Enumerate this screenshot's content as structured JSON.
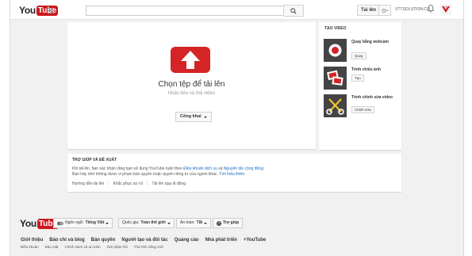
{
  "header": {
    "logo_you": "You",
    "logo_tube": "Tube",
    "search_placeholder": "",
    "upload_label": "Tải lên",
    "account_name": "VTTSOLUTION.CO"
  },
  "upload": {
    "title": "Chọn tệp để tải lên",
    "subtitle": "Hoặc kéo và thả video",
    "privacy_label": "Công khai"
  },
  "create_video": {
    "title": "TẠO VIDEO",
    "tools": [
      {
        "name": "Quay bằng webcam",
        "button": "Quay"
      },
      {
        "name": "Trình chiếu ảnh",
        "button": "Tạo"
      },
      {
        "name": "Trình chỉnh sửa video",
        "button": "Chỉnh sửa"
      }
    ]
  },
  "help": {
    "title": "TRỢ GIÚP VÀ ĐỀ XUẤT",
    "line1_prefix": "Khi tải lên, bạn xác nhận rằng bạn sử dụng YouTube tuân theo ",
    "terms_link": "Điều khoản dịch vụ",
    "and": " và ",
    "guidelines_link": "Nguyên tắc cộng đồng",
    "line1_suffix": ".",
    "line2_prefix": "Bạn hãy nhớ không được vi phạm bản quyền hoặc quyền riêng tư của người khác. ",
    "learn_more_link": "Tìm hiểu thêm",
    "links": [
      "Hướng dẫn tải lên",
      "Khắc phục sự cố",
      "Tải lên qua di động"
    ]
  },
  "footer": {
    "logo_you": "You",
    "logo_tube": "Tube",
    "language_label": "Ngôn ngữ:",
    "language_value": "Tiếng Việt",
    "country_label": "Quốc gia:",
    "country_value": "Toàn thế giới",
    "safety_label": "An toàn:",
    "safety_value": "Tắt",
    "help_label": "Trợ giúp",
    "primary_links": [
      "Giới thiệu",
      "Báo chí và blog",
      "Bản quyền",
      "Người tạo và đối tác",
      "Quảng cáo",
      "Nhà phát triển",
      "+YouTube"
    ],
    "secondary_links": [
      "Điều khoản",
      "Bảo mật",
      "Chính sách và an toàn",
      "Gửi phản hồi",
      "Thử tính năng mới"
    ]
  },
  "colors": {
    "brand_red": "#cc181e",
    "upload_red": "#d42426",
    "link_blue": "#1a6bc7",
    "background": "#f1f1f1"
  }
}
